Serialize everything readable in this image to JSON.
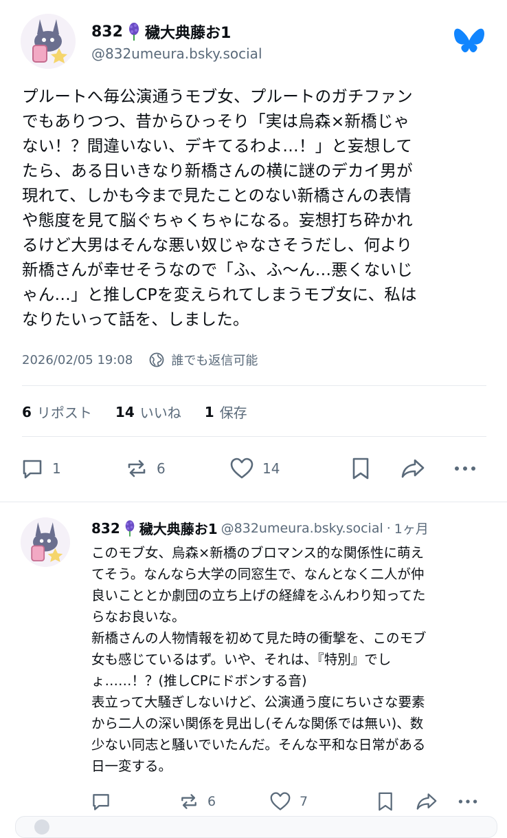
{
  "post": {
    "author_name": "832",
    "author_name_suffix": "穢大典藤お1",
    "handle": "@832umeura.bsky.social",
    "body_lines": [
      "プルートへ毎公演通うモブ女、プルートのガチファン",
      "でもありつつ、昔からひっそり「実は烏森×新橋じゃ",
      "ない！？間違いない、デキてるわよ…！」と妄想して",
      "たら、ある日いきなり新橋さんの横に謎のデカイ男が",
      "現れて、しかも今まで見たことのない新橋さんの表情",
      "や態度を見て脳ぐちゃくちゃになる。妄想打ち砕かれ",
      "るけど大男はそんな悪い奴じゃなさそうだし、何より",
      "新橋さんが幸せそうなので「ふ、ふ〜ん…悪くないじ",
      "ゃん…」と推しCPを変えられてしまうモブ女に、私は",
      "なりたいって話を、しました。"
    ],
    "timestamp": "2026/02/05 19:08",
    "reply_setting": "誰でも返信可能",
    "stats": {
      "reposts_count": "6",
      "reposts_label": "リポスト",
      "likes_count": "14",
      "likes_label": "いいね",
      "saves_count": "1",
      "saves_label": "保存"
    },
    "actions": {
      "reply_count": "1",
      "repost_count": "6",
      "like_count": "14"
    }
  },
  "reply": {
    "author_name": "832",
    "author_name_suffix": "穢大典藤お1",
    "handle": "@832umeura.bsky.social",
    "separator": "·",
    "age": "1ヶ月",
    "body_lines": [
      "このモブ女、烏森×新橋のブロマンス的な関係性に萌え",
      "てそう。なんなら大学の同窓生で、なんとなく二人が仲",
      "良いこととか劇団の立ち上げの経緯をふんわり知ってた",
      "らなお良いな。",
      "新橋さんの人物情報を初めて見た時の衝撃を、このモブ",
      "女も感じているはず。いや、それは、『特別』でし",
      "ょ……！？(推しCPにドボンする音)",
      "表立って大騒ぎしないけど、公演通う度にちいさな要素",
      "から二人の深い関係を見出し(そんな関係では無い)、数",
      "少ない同志と騒いでいたんだ。そんな平和な日常がある",
      "日一変する。"
    ],
    "actions": {
      "reply_count": "",
      "repost_count": "6",
      "like_count": "7"
    }
  },
  "colors": {
    "brand": "#1185fe",
    "muted": "#5a6a7a",
    "divider": "#e6e9ee"
  },
  "icons": [
    "avatar-bunny",
    "hyacinth-emoji",
    "butterfly-logo",
    "globe-icon",
    "reply-icon",
    "repost-icon",
    "heart-icon",
    "bookmark-icon",
    "share-icon",
    "more-icon"
  ]
}
